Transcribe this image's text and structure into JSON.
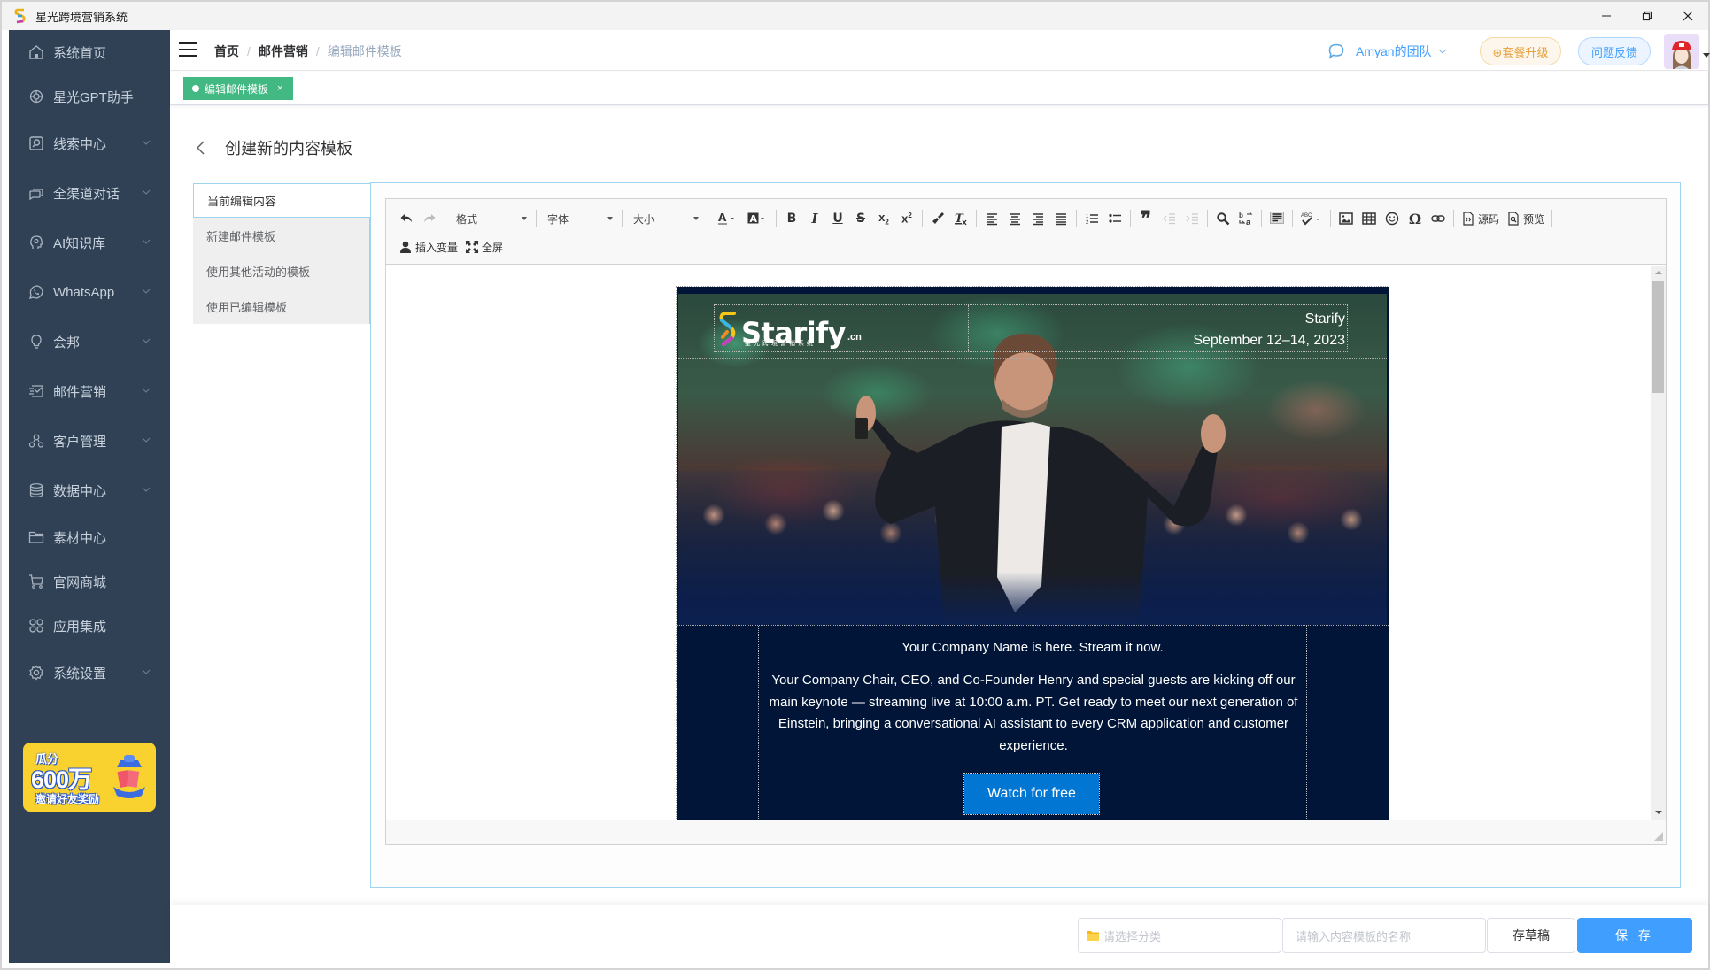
{
  "window": {
    "title": "星光跨境营销系统",
    "controls": [
      "minimize",
      "restore",
      "close"
    ]
  },
  "sidebar": {
    "items": [
      {
        "label": "系统首页",
        "icon": "home-icon",
        "expandable": false
      },
      {
        "label": "星光GPT助手",
        "icon": "openai-icon",
        "expandable": false
      },
      {
        "label": "线索中心",
        "icon": "search-box-icon",
        "expandable": true
      },
      {
        "label": "全渠道对话",
        "icon": "chat-bubbles-icon",
        "expandable": true
      },
      {
        "label": "AI知识库",
        "icon": "brain-head-icon",
        "expandable": true
      },
      {
        "label": "WhatsApp",
        "icon": "whatsapp-icon",
        "expandable": true
      },
      {
        "label": "会邦",
        "icon": "lightbulb-icon",
        "expandable": true
      },
      {
        "label": "邮件营销",
        "icon": "mail-icon",
        "expandable": true
      },
      {
        "label": "客户管理",
        "icon": "users-icon",
        "expandable": true
      },
      {
        "label": "数据中心",
        "icon": "database-icon",
        "expandable": true
      },
      {
        "label": "素材中心",
        "icon": "folder-icon",
        "expandable": false
      },
      {
        "label": "官网商城",
        "icon": "cart-icon",
        "expandable": false
      },
      {
        "label": "应用集成",
        "icon": "apps-icon",
        "expandable": false
      },
      {
        "label": "系统设置",
        "icon": "gear-icon",
        "expandable": true
      }
    ],
    "promo": {
      "line1": "瓜分",
      "line2": "600万",
      "line3": "邀请好友奖励"
    }
  },
  "header": {
    "breadcrumb": [
      "首页",
      "邮件营销",
      "编辑邮件模板"
    ],
    "team": "Amyan的团队",
    "upgrade_label": "⊕套餐升级",
    "feedback_label": "问题反馈"
  },
  "tags": [
    {
      "label": "编辑邮件模板",
      "close": "×",
      "active": true
    }
  ],
  "page": {
    "title": "创建新的内容模板",
    "tabs": [
      "当前编辑内容",
      "新建邮件模板",
      "使用其他活动的模板",
      "使用已编辑模板"
    ],
    "active_tab": 0
  },
  "toolbar": {
    "format": "格式",
    "font": "字体",
    "size": "大小",
    "source": "源码",
    "preview": "预览",
    "insert_variable": "插入变量",
    "fullscreen": "全屏"
  },
  "email": {
    "brand": "Starify",
    "brand_sub": "星光跨境营销系统",
    "brand_tld": ".cn",
    "event_name": "Starify",
    "event_date": "September 12–14, 2023",
    "lead": "Your Company Name is here. Stream it now.",
    "paragraph": "Your Company Chair, CEO, and Co-Founder Henry and special guests are kicking off our main keynote — streaming live at 10:00 a.m. PT. Get ready to meet our next generation of Einstein, bringing a conversational AI assistant to every CRM application and customer experience.",
    "cta": "Watch for free"
  },
  "editor_scroll": {
    "position_fraction": 0.0
  },
  "actions": {
    "category_placeholder": "请选择分类",
    "name_placeholder": "请输入内容模板的名称",
    "draft_label": "存草稿",
    "save_label": "保 存"
  },
  "colors": {
    "sidebar_bg": "#304156",
    "accent": "#409eff",
    "tag_green": "#42b983",
    "email_bg": "#001538",
    "cta": "#0176d3",
    "upgrade": "#e6a23c"
  }
}
